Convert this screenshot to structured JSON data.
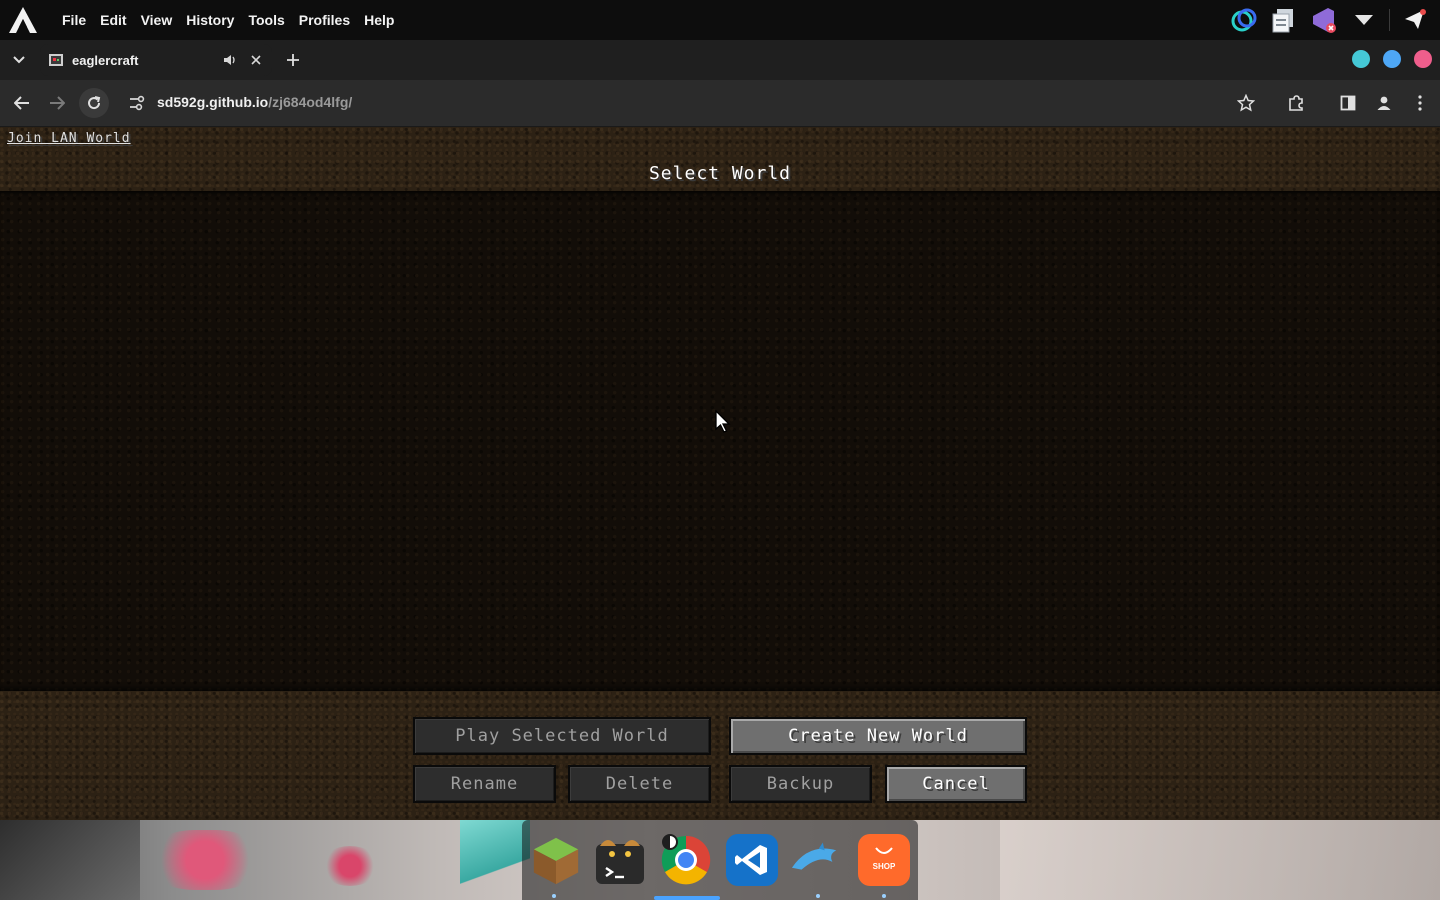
{
  "menubar": {
    "items": [
      "File",
      "Edit",
      "View",
      "History",
      "Tools",
      "Profiles",
      "Help"
    ]
  },
  "tray": {
    "icons": [
      "sync-icon",
      "notes-icon",
      "visual-studio-icon",
      "dropdown-icon",
      "notification-icon"
    ]
  },
  "tabs": [
    {
      "title": "eaglercraft",
      "audio": true
    }
  ],
  "addressbar": {
    "host": "sd592g.github.io",
    "path": "/zj684od4lfg/"
  },
  "window_controls": {
    "colors": [
      "#45c8d6",
      "#4ea7f5",
      "#ef5e8c"
    ]
  },
  "game": {
    "join_lan": "Join LAN World",
    "title": "Select World",
    "buttons": {
      "play": "Play Selected World",
      "create": "Create New World",
      "rename": "Rename",
      "delete": "Delete",
      "backup": "Backup",
      "cancel": "Cancel"
    }
  },
  "dock": {
    "apps": [
      "minecraft-icon",
      "terminal-icon",
      "chrome-icon",
      "vscode-icon",
      "dolphin-icon",
      "shop-icon"
    ],
    "shop_label": "SHOP"
  }
}
